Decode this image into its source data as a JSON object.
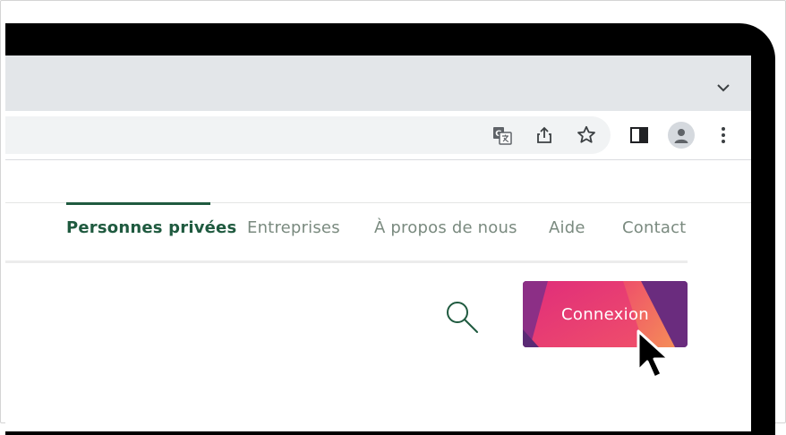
{
  "browser": {
    "toolbar_icons": [
      "translate-icon",
      "share-icon",
      "bookmark-star-icon",
      "side-panel-icon",
      "profile-icon",
      "more-menu-icon"
    ],
    "tab_dropdown_icon": "chevron-down-icon"
  },
  "site_nav": {
    "items": [
      {
        "label": "Personnes privées",
        "active": true
      },
      {
        "label": "Entreprises",
        "active": false
      },
      {
        "label": "À propos de nous",
        "active": false
      },
      {
        "label": "Aide",
        "active": false
      },
      {
        "label": "Contact",
        "active": false
      }
    ]
  },
  "actions": {
    "search_icon": "search-icon",
    "login_label": "Connexion"
  },
  "colors": {
    "brand_green": "#1f5a3f",
    "nav_inactive": "#7a8a7f",
    "button_pink": "#e8336e",
    "button_purple": "#6a2c7e",
    "button_orange": "#f07c5c",
    "tabstrip": "#e3e6e9"
  }
}
